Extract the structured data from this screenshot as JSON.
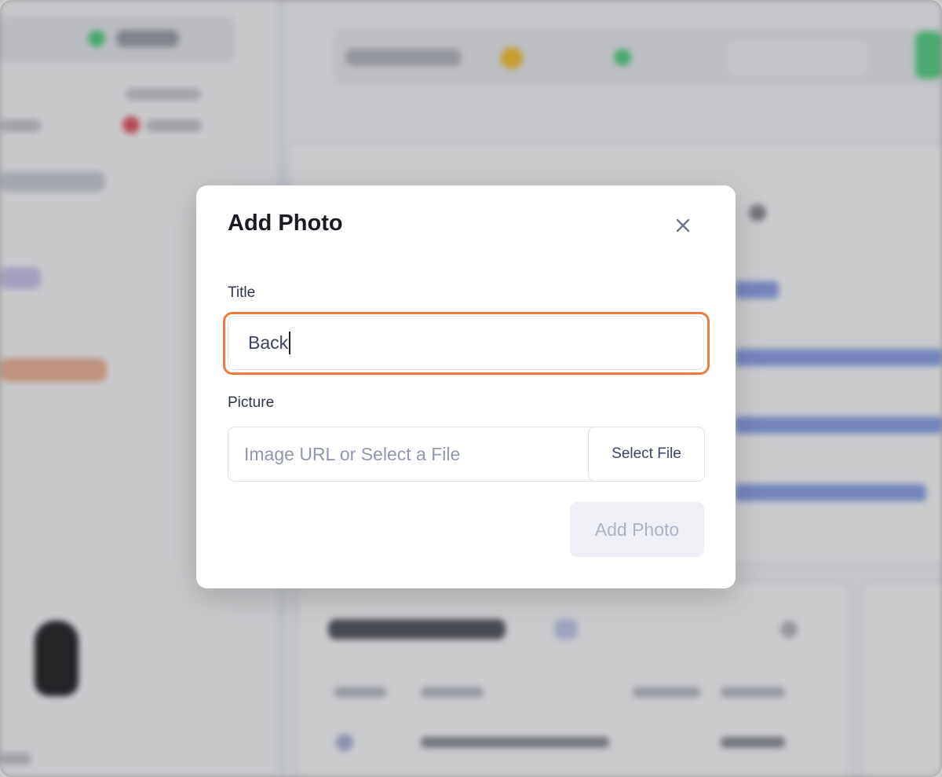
{
  "modal": {
    "title": "Add Photo",
    "close_icon": "close-icon",
    "title_field": {
      "label": "Title",
      "value": "Back"
    },
    "picture_field": {
      "label": "Picture",
      "placeholder": "Image URL or Select a File",
      "value": ""
    },
    "select_file_label": "Select File",
    "submit_label": "Add Photo",
    "submit_disabled": true
  },
  "colors": {
    "focus_ring": "#ee7a3c",
    "overlay": "rgba(0,0,0,0.18)",
    "disabled_button_bg": "#eef0f5",
    "disabled_button_text": "#aeb3c4"
  }
}
